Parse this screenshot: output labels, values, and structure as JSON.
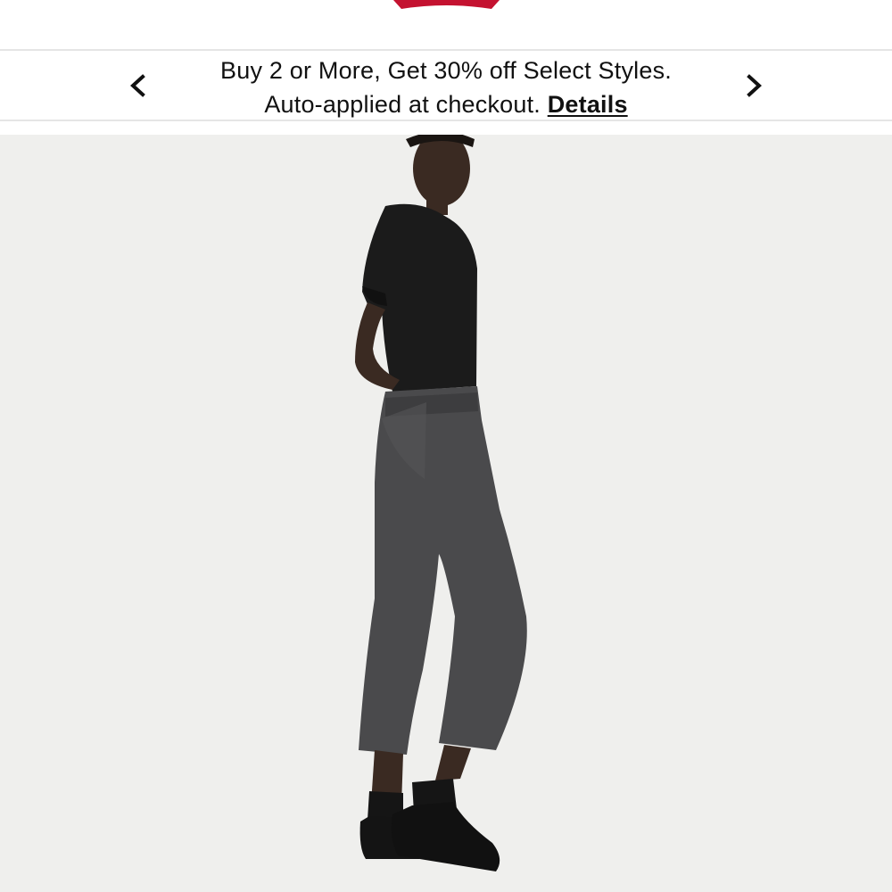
{
  "header": {
    "logo_icon": "levis-batwing-logo-icon",
    "brand_color": "#c41230"
  },
  "promo": {
    "line1": "Buy 2 or More, Get 30% off Select Styles.",
    "line2_prefix": "Auto-applied at checkout. ",
    "details_label": "Details",
    "prev_icon": "chevron-left-icon",
    "next_icon": "chevron-right-icon"
  },
  "product": {
    "image_icon": "product-photo-model-jeans",
    "background_color": "#efefed"
  }
}
